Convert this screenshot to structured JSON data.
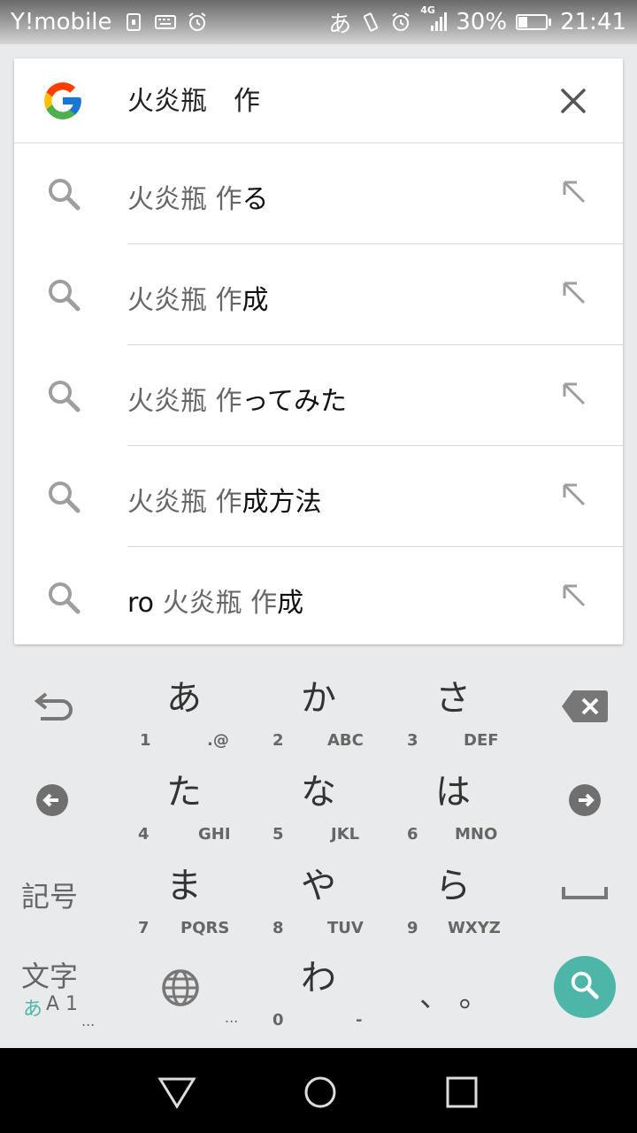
{
  "status_bar": {
    "carrier": "Y!mobile",
    "ime_indicator": "あ",
    "network": "4G",
    "battery_percent": "30%",
    "battery_level": 0.3,
    "time": "21:41",
    "icons": [
      "sim-icon",
      "keyboard-icon",
      "alarm-icon",
      "vibrate-icon",
      "alarm-icon",
      "signal-icon",
      "battery-icon"
    ]
  },
  "search": {
    "logo": "google-logo",
    "query": "火炎瓶　作",
    "clear_icon": "close-icon"
  },
  "suggestions": [
    {
      "prefix": "火炎瓶 作",
      "suffix": "る"
    },
    {
      "prefix": "火炎瓶 作",
      "suffix": "成"
    },
    {
      "prefix": "火炎瓶 作",
      "suffix": "ってみた"
    },
    {
      "prefix": "火炎瓶 作",
      "suffix": "成方法"
    },
    {
      "lead": "ro ",
      "prefix": "火炎瓶 作",
      "suffix": "成"
    }
  ],
  "keyboard": {
    "keys": [
      {
        "kana": "あ",
        "num": "1",
        "latin": ".@"
      },
      {
        "kana": "か",
        "num": "2",
        "latin": "ABC"
      },
      {
        "kana": "さ",
        "num": "3",
        "latin": "DEF"
      },
      {
        "kana": "た",
        "num": "4",
        "latin": "GHI"
      },
      {
        "kana": "な",
        "num": "5",
        "latin": "JKL"
      },
      {
        "kana": "は",
        "num": "6",
        "latin": "MNO"
      },
      {
        "kana": "ま",
        "num": "7",
        "latin": "PQRS"
      },
      {
        "kana": "や",
        "num": "8",
        "latin": "TUV"
      },
      {
        "kana": "ら",
        "num": "9",
        "latin": "WXYZ"
      },
      {
        "kana": "わ",
        "num": "0",
        "latin": "-"
      }
    ],
    "symbols_label": "記号",
    "mode_label": "文字",
    "mode_sub_kana": "あ",
    "mode_sub_rest": "A 1",
    "ellipsis": "...",
    "punct_label": "、 。",
    "accent_color": "#4db6a8"
  },
  "nav": {
    "icons": [
      "back-icon",
      "home-icon",
      "recents-icon"
    ]
  }
}
